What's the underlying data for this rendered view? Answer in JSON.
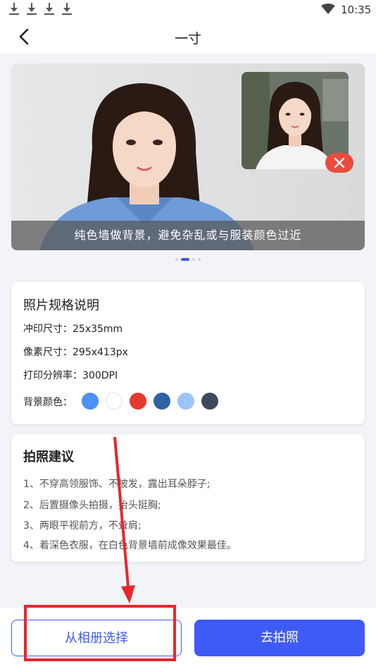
{
  "status_bar": {
    "time": "10:35",
    "download_icons": [
      "download-icon",
      "download-icon",
      "download-icon",
      "download-icon"
    ],
    "wifi_icon": "wifi-icon"
  },
  "header": {
    "title": "一寸",
    "back_icon": "back-arrow-icon"
  },
  "banner": {
    "caption": "纯色墙做背景，避免杂乱或与服装颜色过近",
    "wrong_badge_icon": "close-icon",
    "page_count": 4,
    "active_page": 2
  },
  "spec": {
    "title": "照片规格说明",
    "print_size": "冲印尺寸：25x35mm",
    "pixel_size": "像素尺寸：295x413px",
    "resolution": "打印分辨率：300DPI",
    "bg_label": "背景颜色：",
    "bg_colors": [
      "#4a90f5",
      "#ffffff",
      "#e53a2f",
      "#2f62a3",
      "#9cc4f8",
      "#3c4a5e"
    ]
  },
  "advice": {
    "title": "拍照建议",
    "items": [
      "1、不穿高领服饰、不披发，露出耳朵脖子;",
      "2、后置摄像头拍摄，抬头挺胸;",
      "3、两眼平视前方，不耸肩;",
      "4、着深色衣服，在白色背景墙前成像效果最佳。"
    ]
  },
  "buttons": {
    "album": "从相册选择",
    "camera": "去拍照"
  },
  "colors": {
    "accent": "#3f5bf5",
    "annotation": "#e8262b"
  }
}
